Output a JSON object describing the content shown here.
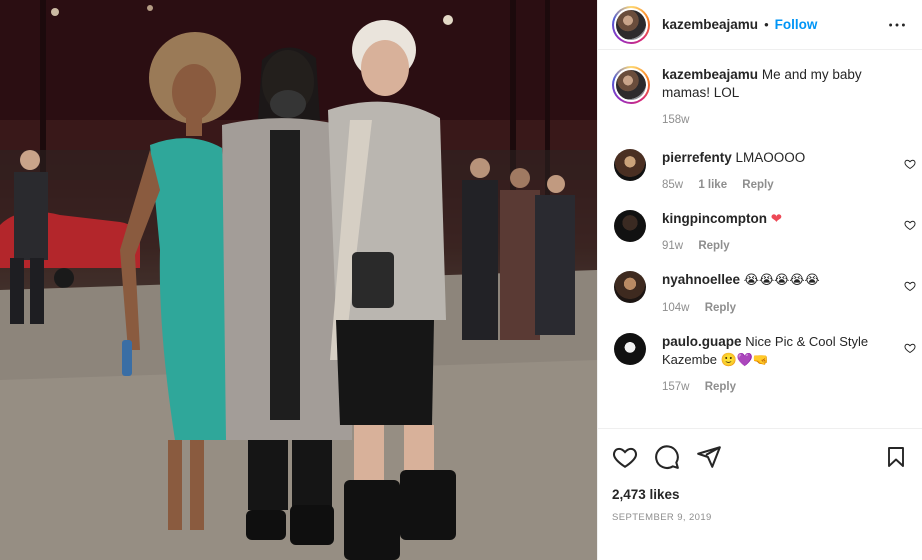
{
  "post": {
    "username": "kazembeajamu",
    "separator": "•",
    "follow_label": "Follow",
    "caption": "Me and my baby mamas! LOL",
    "caption_age": "158w",
    "likes": "2,473 likes",
    "date": "September 9, 2019"
  },
  "comments": [
    {
      "username": "pierrefenty",
      "text": "LMAOOOO",
      "age": "85w",
      "likes": "1 like",
      "reply": "Reply"
    },
    {
      "username": "kingpincompton",
      "text": "❤",
      "age": "91w",
      "likes": "",
      "reply": "Reply"
    },
    {
      "username": "nyahnoellee",
      "text": "😭😭😭😭😭",
      "age": "104w",
      "likes": "",
      "reply": "Reply"
    },
    {
      "username": "paulo.guape",
      "text": "Nice Pic & Cool Style Kazembe 🙂💜🤜",
      "age": "157w",
      "likes": "",
      "reply": "Reply"
    }
  ],
  "icons": {
    "more": "more-options-icon",
    "like": "heart-icon",
    "comment": "comment-icon",
    "share": "paper-plane-icon",
    "save": "bookmark-icon"
  },
  "colors": {
    "accent": "#0095f6",
    "text": "#262626",
    "muted": "#8e8e8e",
    "heart_red": "#ed4956"
  }
}
